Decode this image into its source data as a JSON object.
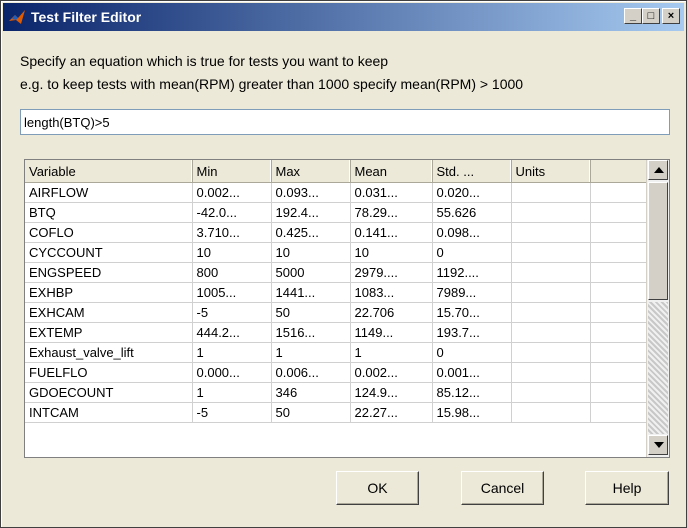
{
  "window": {
    "title": "Test Filter Editor"
  },
  "instructions": {
    "line1": "Specify an equation which is true for tests you want to keep",
    "line2": "e.g. to keep tests with mean(RPM) greater than 1000 specify mean(RPM) > 1000"
  },
  "equation": {
    "value": "length(BTQ)>5"
  },
  "table": {
    "columns": [
      "Variable",
      "Min",
      "Max",
      "Mean",
      "Std. ...",
      "Units",
      ""
    ],
    "rows": [
      [
        "AIRFLOW",
        "0.002...",
        "0.093...",
        "0.031...",
        "0.020...",
        "",
        ""
      ],
      [
        "BTQ",
        "-42.0...",
        "192.4...",
        "78.29...",
        "55.626",
        "",
        ""
      ],
      [
        "COFLO",
        "3.710...",
        "0.425...",
        "0.141...",
        "0.098...",
        "",
        ""
      ],
      [
        "CYCCOUNT",
        "10",
        "10",
        "10",
        "0",
        "",
        ""
      ],
      [
        "ENGSPEED",
        "800",
        "5000",
        "2979....",
        "1192....",
        "",
        ""
      ],
      [
        "EXHBP",
        "1005...",
        "1441...",
        "1083...",
        "7989...",
        "",
        ""
      ],
      [
        "EXHCAM",
        "-5",
        "50",
        "22.706",
        "15.70...",
        "",
        ""
      ],
      [
        "EXTEMP",
        "444.2...",
        "1516...",
        "1149...",
        "193.7...",
        "",
        ""
      ],
      [
        "Exhaust_valve_lift",
        "1",
        "1",
        "1",
        "0",
        "",
        ""
      ],
      [
        "FUELFLO",
        "0.000...",
        "0.006...",
        "0.002...",
        "0.001...",
        "",
        ""
      ],
      [
        "GDOECOUNT",
        "1",
        "346",
        "124.9...",
        "85.12...",
        "",
        ""
      ],
      [
        "INTCAM",
        "-5",
        "50",
        "22.27...",
        "15.98...",
        "",
        ""
      ]
    ]
  },
  "buttons": {
    "ok": "OK",
    "cancel": "Cancel",
    "help": "Help"
  },
  "window_controls": {
    "minimize": "_",
    "maximize": "□",
    "close": "×"
  },
  "icons": {
    "app": "matlab-icon",
    "scroll_up": "arrow-up-icon",
    "scroll_down": "arrow-down-icon"
  },
  "colors": {
    "title_start": "#0a246a",
    "title_end": "#a6caf0",
    "face": "#ece9d8"
  }
}
